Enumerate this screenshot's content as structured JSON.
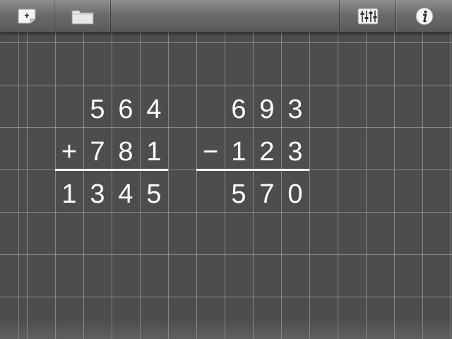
{
  "toolbar": {
    "buttons": [
      {
        "id": "new",
        "icon": "new-note-icon"
      },
      {
        "id": "open",
        "icon": "folder-icon"
      },
      {
        "id": "settings",
        "icon": "sliders-icon"
      },
      {
        "id": "info",
        "icon": "info-icon"
      }
    ]
  },
  "problems": [
    {
      "operation": "addition",
      "operand1": "564",
      "operand2": "781",
      "operator": "+",
      "result": "1345",
      "rows": [
        [
          "",
          "5",
          "6",
          "4"
        ],
        [
          "+",
          "7",
          "8",
          "1"
        ],
        [
          "1",
          "3",
          "4",
          "5"
        ]
      ]
    },
    {
      "operation": "subtraction",
      "operand1": "693",
      "operand2": "123",
      "operator": "−",
      "result": "570",
      "rows": [
        [
          "",
          "6",
          "9",
          "3"
        ],
        [
          "−",
          "1",
          "2",
          "3"
        ],
        [
          "",
          "5",
          "7",
          "0"
        ]
      ]
    }
  ],
  "colors": {
    "board": "#4d4d4d",
    "grid": "#cdcdcd",
    "digits": "#ffffff",
    "toolbar": "#6a6a6a"
  }
}
